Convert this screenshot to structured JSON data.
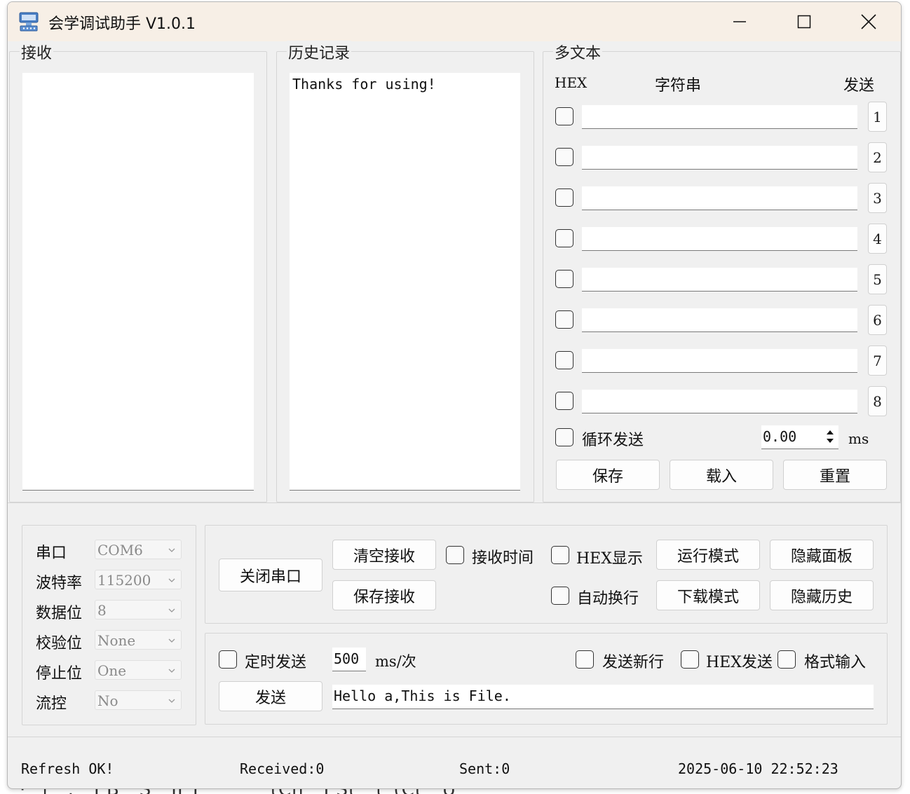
{
  "window": {
    "title": "会学调试助手 V1.0.1"
  },
  "receive": {
    "title": "接收",
    "content": ""
  },
  "history": {
    "title": "历史记录",
    "content": "Thanks for using!"
  },
  "multitext": {
    "title": "多文本",
    "col_hex": "HEX",
    "col_string": "字符串",
    "col_send": "发送",
    "rows": [
      {
        "index": "1",
        "value": ""
      },
      {
        "index": "2",
        "value": ""
      },
      {
        "index": "3",
        "value": ""
      },
      {
        "index": "4",
        "value": ""
      },
      {
        "index": "5",
        "value": ""
      },
      {
        "index": "6",
        "value": ""
      },
      {
        "index": "7",
        "value": ""
      },
      {
        "index": "8",
        "value": ""
      }
    ],
    "loop_label": "循环发送",
    "loop_value": "0.00",
    "loop_unit": "ms",
    "save": "保存",
    "load": "载入",
    "reset": "重置"
  },
  "serial": {
    "port_label": "串口",
    "port_value": "COM6",
    "baud_label": "波特率",
    "baud_value": "115200",
    "data_label": "数据位",
    "data_value": "8",
    "parity_label": "校验位",
    "parity_value": "None",
    "stop_label": "停止位",
    "stop_value": "One",
    "flow_label": "流控",
    "flow_value": "No"
  },
  "controls": {
    "close_port": "关闭串口",
    "clear_receive": "清空接收",
    "save_receive": "保存接收",
    "receive_time": "接收时间",
    "hex_display": "HEX显示",
    "auto_wrap": "自动换行",
    "run_mode": "运行模式",
    "download_mode": "下载模式",
    "hide_panel": "隐藏面板",
    "hide_history": "隐藏历史"
  },
  "send": {
    "timed_label": "定时发送",
    "interval_value": "500",
    "interval_unit": "ms/次",
    "new_line": "发送新行",
    "hex_send": "HEX发送",
    "format_input": "格式输入",
    "send_button": "发送",
    "send_text": "Hello a,This is File."
  },
  "status": {
    "message": "Refresh OK!",
    "received": "Received:0",
    "sent": "Sent:0",
    "datetime": "2025-06-10 22:52:23"
  },
  "background": {
    "peek_text": "·  i  .  I B  S  II T       tCh  I St  t (Ct  U                          "
  },
  "colors": {
    "window_bg": "#f0f0f0",
    "titlebar_bg": "#f7efe6",
    "field_bg": "#ffffff"
  }
}
